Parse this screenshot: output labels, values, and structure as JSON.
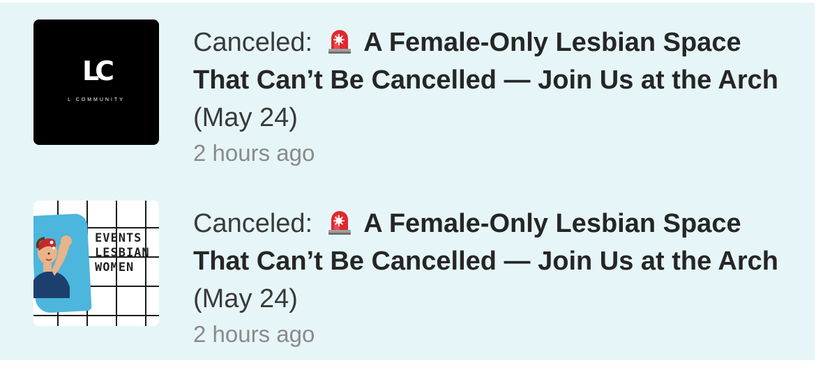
{
  "notifications": [
    {
      "thumbnail_icon": "l-community-logo",
      "logo_text": "LC",
      "logo_subtext": "L COMMUNITY",
      "status_prefix": "Canceled:",
      "alert_icon": "rotating-light-icon",
      "event_name": "A Female-Only Lesbian Space That Can’t Be Cancelled — Join Us at the Arch",
      "event_date": "(May 24)",
      "timestamp": "2 hours ago"
    },
    {
      "thumbnail_icon": "events-lesbian-women-poster",
      "poster_lines": [
        "EVENTS",
        "LESBIAN",
        "WOMEN"
      ],
      "status_prefix": "Canceled:",
      "alert_icon": "rotating-light-icon",
      "event_name": "A Female-Only Lesbian Space That Can’t Be Cancelled — Join Us at the Arch",
      "event_date": "(May 24)",
      "timestamp": "2 hours ago"
    }
  ],
  "colors": {
    "background": "#e6f6f8",
    "title_text": "#272727",
    "timestamp_text": "#8a8a8a",
    "poster_blue": "#4db6dc",
    "alarm_red": "#e0282e"
  }
}
